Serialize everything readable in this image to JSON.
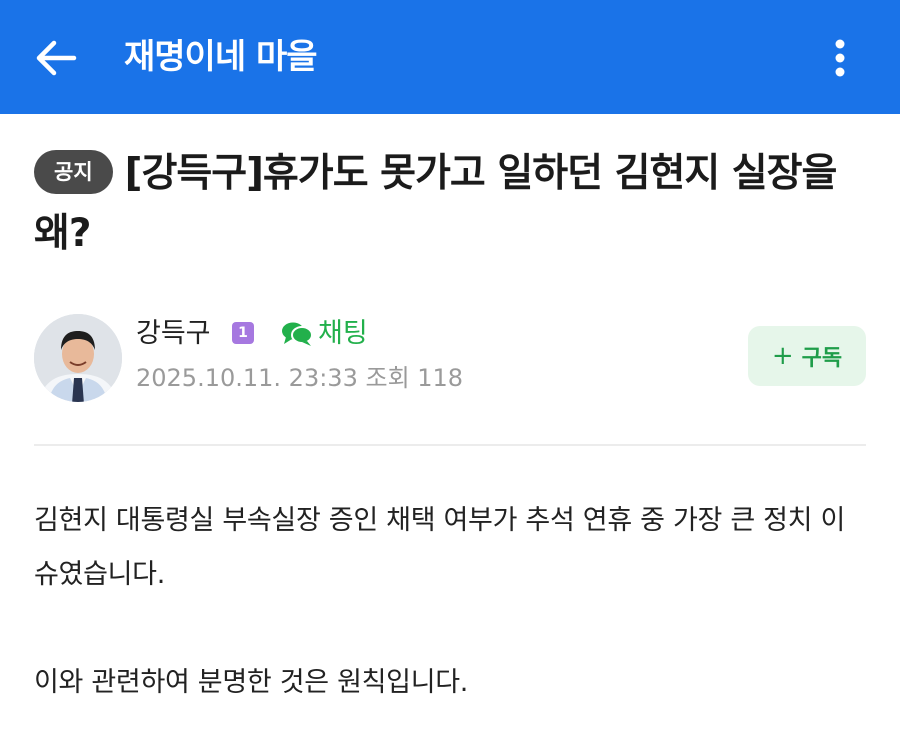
{
  "appbar": {
    "title": "재명이네 마을",
    "back_icon": "arrow-left-icon",
    "more_icon": "more-vertical-icon",
    "color": "#1a73e8"
  },
  "post": {
    "badge": "공지",
    "title": "[강득구]휴가도 못가고 일하던 김현지 실장을 왜?"
  },
  "author": {
    "name": "강득구",
    "level": "1",
    "chat_label": "채팅",
    "date": "2025.10.11. 23:33",
    "views_label": "조회 118"
  },
  "subscribe": {
    "plus": "+",
    "label": "구독"
  },
  "body": {
    "paragraphs": [
      "김현지 대통령실 부속실장 증인 채택 여부가 추석 연휴 중 가장 큰 정치 이슈였습니다.",
      "이와 관련하여 분명한 것은 원칙입니다."
    ]
  }
}
